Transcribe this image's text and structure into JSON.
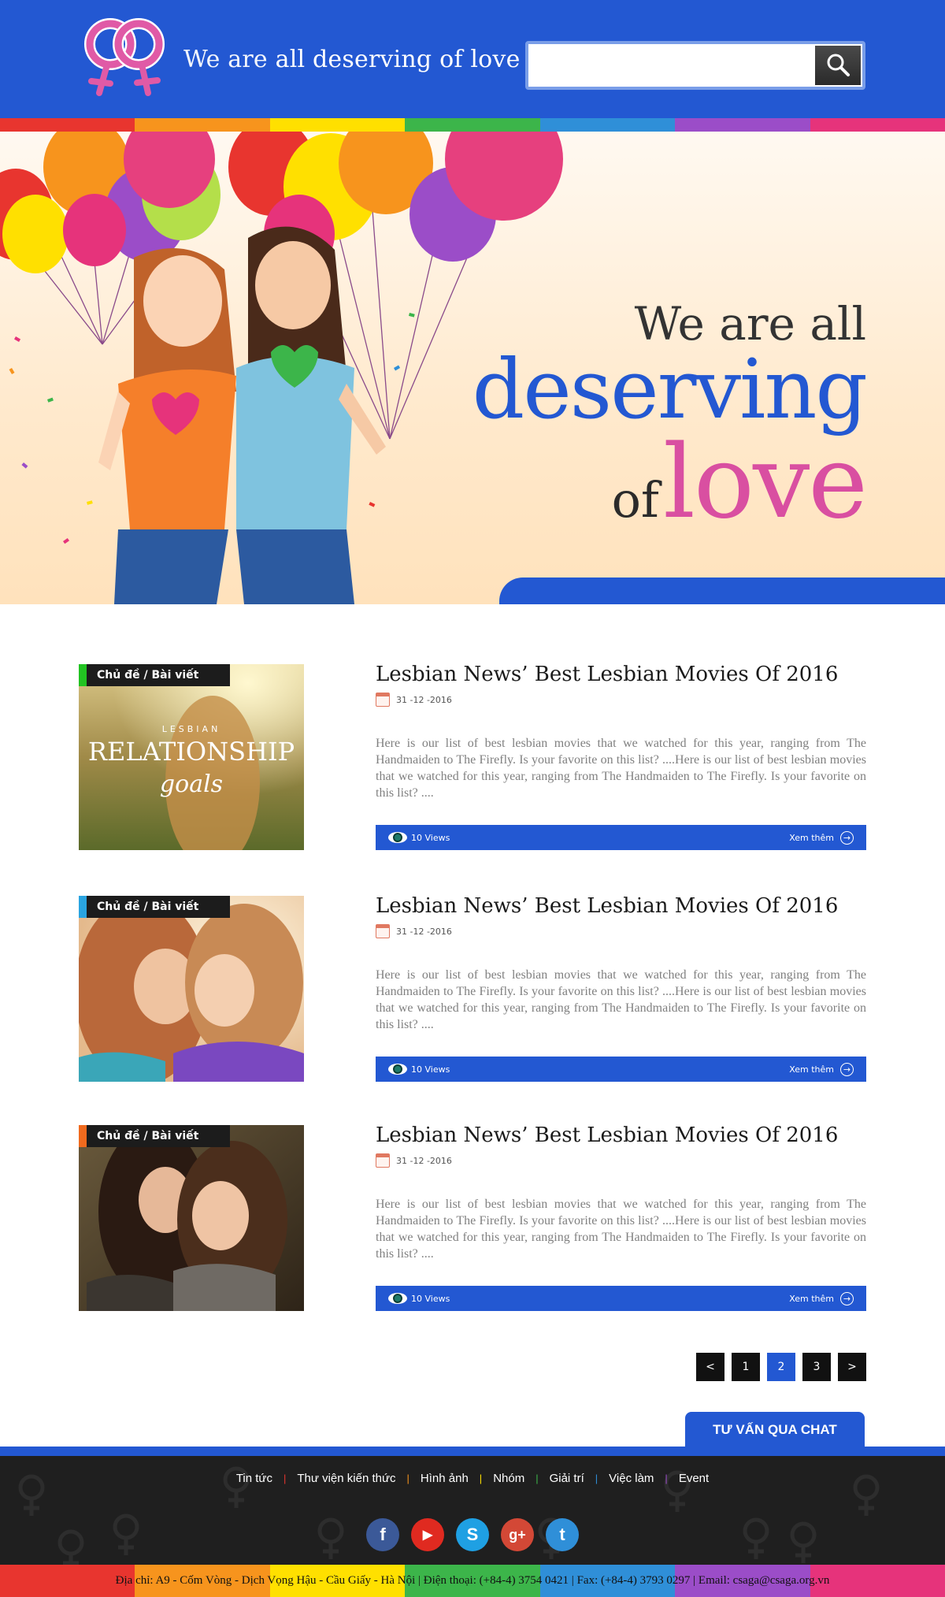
{
  "header": {
    "tagline_light": "We are",
    "tagline_bold": "all deserving of love",
    "search": {
      "value": "",
      "placeholder": ""
    }
  },
  "colors": {
    "brand_blue": "#2358d2",
    "pink": "#d94fa1",
    "rainbow": [
      "#e8352f",
      "#f7941d",
      "#ffe000",
      "#3cb54a",
      "#2f8fd8",
      "#9b4dc8",
      "#e6337b"
    ]
  },
  "hero": {
    "line1": "We are all",
    "line2": "deserving",
    "line3_of": "of",
    "line3_love": "love"
  },
  "articles": [
    {
      "category": "Chủ đề / Bài viết",
      "category_color": "#22c322",
      "title": "Lesbian News’ Best Lesbian Movies Of 2016",
      "date": "31 -12 -2016",
      "description": "Here is our list of best lesbian movies that we watched for this year, ranging from The Handmaiden to The Firefly. Is your favorite on this list? ....Here is our list of best lesbian movies that we watched for this year, ranging from The Handmaiden to The Firefly. Is your favorite on this list? ....",
      "views": "10 Views",
      "more": "Xem thêm",
      "image": "relationship-goals-photo",
      "image_caption_top": "LESBIAN",
      "image_caption_main": "RELATIONSHIP",
      "image_caption_script": "goals"
    },
    {
      "category": "Chủ đề / Bài viết",
      "category_color": "#2aa4e0",
      "title": "Lesbian News’ Best Lesbian Movies Of 2016",
      "date": "31 -12 -2016",
      "description": "Here is our list of best lesbian movies that we watched for this year, ranging from The Handmaiden to The Firefly. Is your favorite on this list? ....Here is our list of best lesbian movies that we watched for this year, ranging from The Handmaiden to The Firefly. Is your favorite on this list? ....",
      "views": "10 Views",
      "more": "Xem thêm",
      "image": "couple-embrace-photo"
    },
    {
      "category": "Chủ đề / Bài viết",
      "category_color": "#f06a1e",
      "title": "Lesbian News’ Best Lesbian Movies Of 2016",
      "date": "31 -12 -2016",
      "description": "Here is our list of best lesbian movies that we watched for this year, ranging from The Handmaiden to The Firefly. Is your favorite on this list? ....Here is our list of best lesbian movies that we watched for this year, ranging from The Handmaiden to The Firefly. Is your favorite on this list? ....",
      "views": "10 Views",
      "more": "Xem thêm",
      "image": "couple-smiling-photo"
    }
  ],
  "pagination": {
    "prev": "<",
    "pages": [
      "1",
      "2",
      "3"
    ],
    "active": "2",
    "next": ">"
  },
  "chat_button": "TƯ VẤN QUA CHAT",
  "footer": {
    "nav": [
      {
        "label": "Tin tức",
        "sep_color": "#e8352f"
      },
      {
        "label": "Thư viện kiến thức",
        "sep_color": "#f7941d"
      },
      {
        "label": "Hình ảnh",
        "sep_color": "#ffe000"
      },
      {
        "label": "Nhóm",
        "sep_color": "#3cb54a"
      },
      {
        "label": "Giải trí",
        "sep_color": "#2f8fd8"
      },
      {
        "label": "Việc làm",
        "sep_color": "#9b4dc8"
      },
      {
        "label": "Event",
        "sep_color": ""
      }
    ],
    "socials": [
      {
        "name": "facebook-icon",
        "glyph": "f",
        "color": "#3b5998"
      },
      {
        "name": "youtube-icon",
        "glyph": "▶",
        "color": "#e02a20"
      },
      {
        "name": "skype-icon",
        "glyph": "S",
        "color": "#1fa0e3"
      },
      {
        "name": "google-plus-icon",
        "glyph": "g+",
        "color": "#d34836"
      },
      {
        "name": "twitter-icon",
        "glyph": "t",
        "color": "#2f8fd8"
      }
    ],
    "contact": "Địa chỉ: A9 - Cốm Vòng - Dịch Vọng Hậu - Cầu Giấy - Hà Nội  |  Điện thoại: (+84-4) 3754 0421  |  Fax: (+84-4) 3793 0297  |  Email: csaga@csaga.org.vn"
  }
}
